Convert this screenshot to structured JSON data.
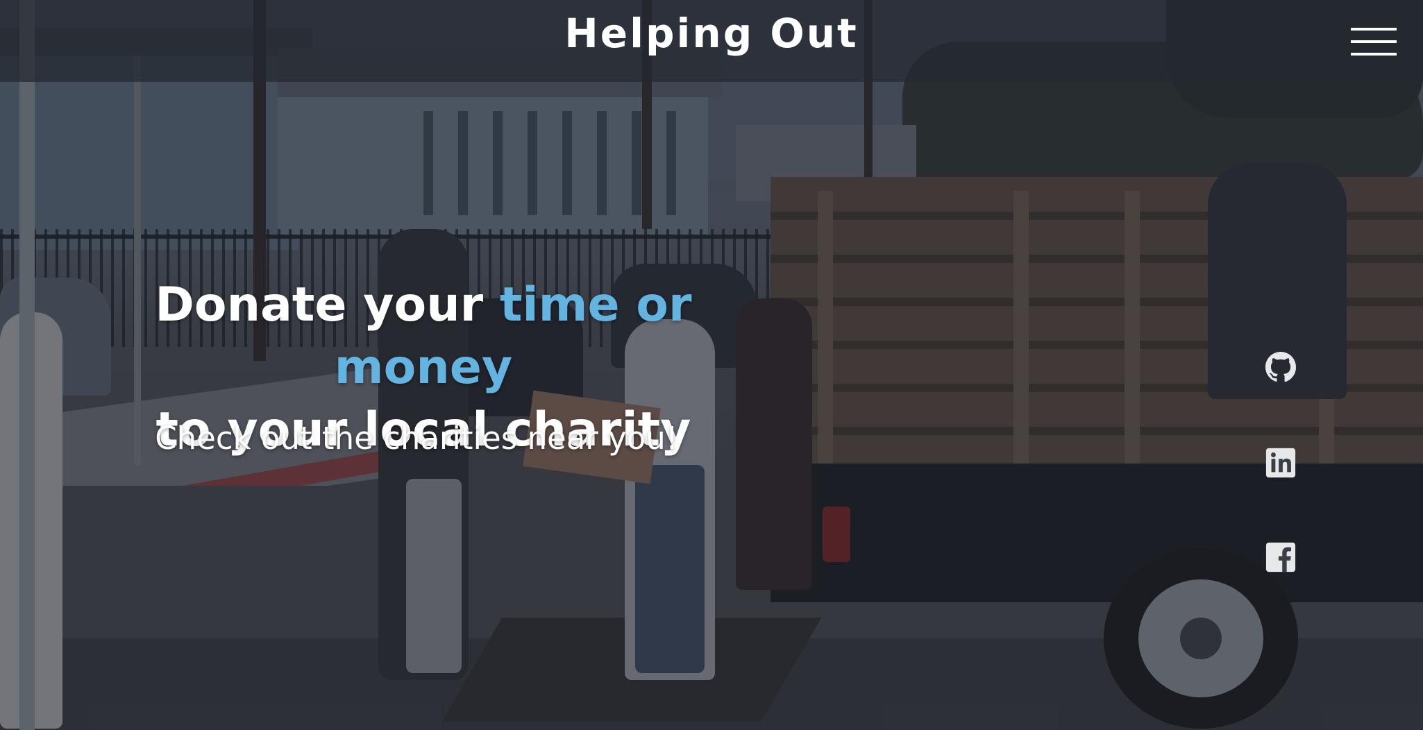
{
  "navbar": {
    "brand": "Helping Out",
    "menu_icon": "hamburger-menu-icon"
  },
  "hero": {
    "line1_prefix": "Donate your ",
    "line1_accent": "time or money",
    "line2": "to your local charity",
    "subtitle": "Check out the charities near you!"
  },
  "social": [
    {
      "icon": "github-icon"
    },
    {
      "icon": "linkedin-icon"
    },
    {
      "icon": "facebook-icon"
    }
  ],
  "colors": {
    "accent": "#63b4e1",
    "text": "#ffffff",
    "navbar_bg": "#242831"
  }
}
